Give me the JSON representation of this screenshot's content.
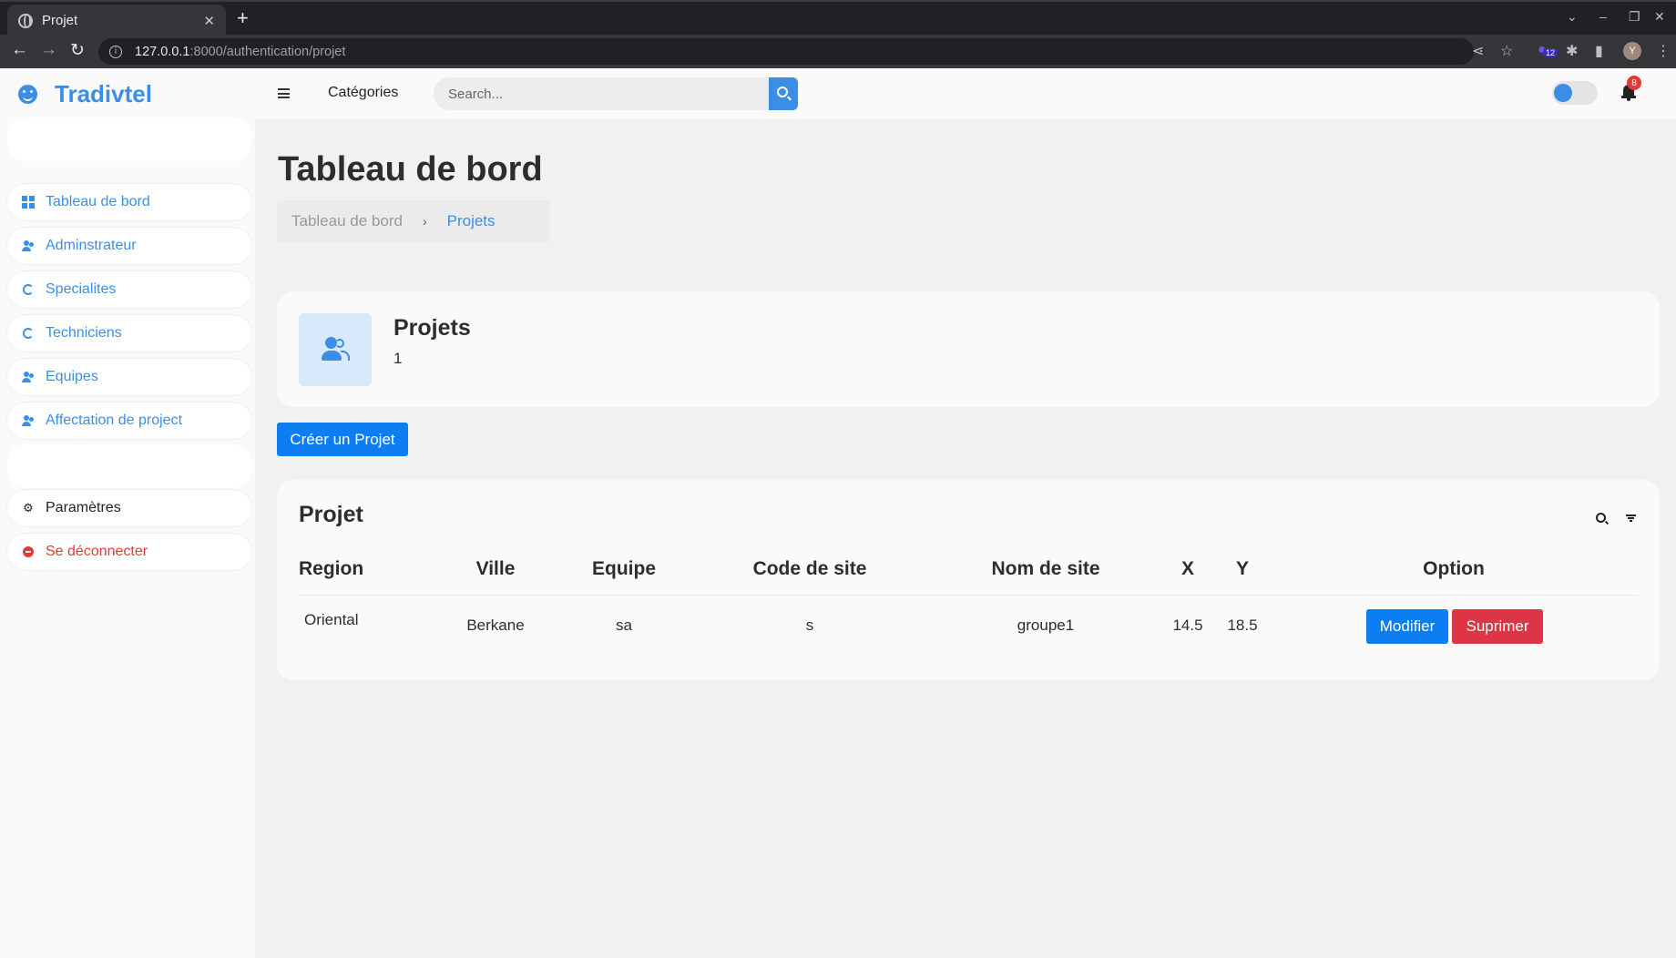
{
  "browser": {
    "tab_title": "Projet",
    "tab_close": "✕",
    "new_tab": "+",
    "url_host": "127.0.0.1",
    "url_path": ":8000/authentication/projet",
    "extension_badge": "12",
    "profile_initial": "Y"
  },
  "header": {
    "brand": "Tradivtel",
    "categories": "Catégories",
    "search_placeholder": "Search...",
    "notification_count": "8"
  },
  "sidebar": {
    "items": [
      {
        "label": "Tableau de bord",
        "icon": "grid-icon"
      },
      {
        "label": "Adminstrateur",
        "icon": "users-icon"
      },
      {
        "label": "Specialites",
        "icon": "refresh-icon"
      },
      {
        "label": "Techniciens",
        "icon": "refresh-icon"
      },
      {
        "label": "Equipes",
        "icon": "users-icon"
      },
      {
        "label": "Affectation de project",
        "icon": "users-icon"
      }
    ],
    "settings": "Paramètres",
    "logout": "Se déconnecter"
  },
  "main": {
    "title": "Tableau de bord",
    "breadcrumb": [
      "Tableau de bord",
      "Projets"
    ],
    "stats": {
      "title": "Projets",
      "count": "1"
    },
    "create_button": "Créer un Projet",
    "table": {
      "title": "Projet",
      "columns": [
        "Region",
        "Ville",
        "Equipe",
        "Code de site",
        "Nom de site",
        "X",
        "Y",
        "Option"
      ],
      "rows": [
        {
          "region": "Oriental",
          "ville": "Berkane",
          "equipe": "sa",
          "code": "s",
          "nom": "groupe1",
          "x": "14.5",
          "y": "18.5"
        }
      ],
      "edit_label": "Modifier",
      "delete_label": "Suprimer"
    }
  },
  "colors": {
    "accent": "#3b8ee6",
    "primary_button": "#0d7ef2",
    "danger": "#dc3545"
  }
}
